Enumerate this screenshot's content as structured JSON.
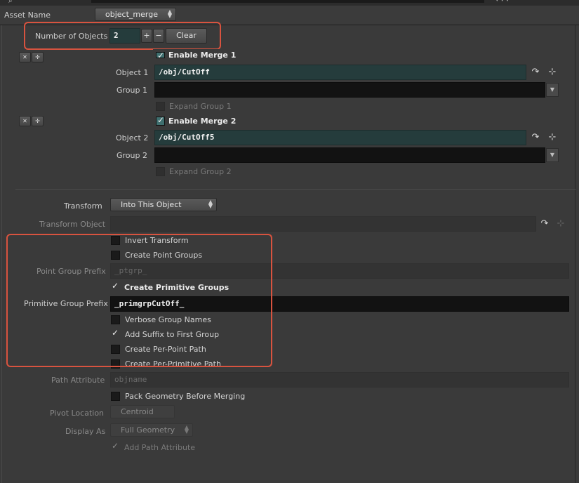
{
  "header": {
    "asset_name_label": "Asset Name",
    "asset_name_value": "object_merge"
  },
  "objects": {
    "label": "Number of Objects",
    "value": "2",
    "plus": "+",
    "minus": "−",
    "clear": "Clear",
    "items": [
      {
        "enable_label": "Enable Merge 1",
        "object_label": "Object 1",
        "object_value": "/obj/CutOff",
        "group_label": "Group 1",
        "group_value": "",
        "expand_label": "Expand Group 1"
      },
      {
        "enable_label": "Enable Merge 2",
        "object_label": "Object 2",
        "object_value": "/obj/CutOff5",
        "group_label": "Group 2",
        "group_value": "",
        "expand_label": "Expand Group 2"
      }
    ]
  },
  "transform": {
    "label": "Transform",
    "value": "Into This Object",
    "object_label": "Transform Object",
    "object_value": ""
  },
  "options": {
    "invert_transform": "Invert Transform",
    "create_point_groups": "Create Point Groups",
    "point_prefix_label": "Point Group Prefix",
    "point_prefix_value": "_ptgrp_",
    "create_primitive_groups": "Create Primitive Groups",
    "prim_prefix_label": "Primitive Group Prefix",
    "prim_prefix_value": "_primgrpCutOff_",
    "verbose_group_names": "Verbose Group Names",
    "add_suffix": "Add Suffix to First Group",
    "per_point_path": "Create Per-Point Path",
    "per_prim_path": "Create Per-Primitive Path"
  },
  "path": {
    "label": "Path Attribute",
    "value": "objname",
    "pack_geometry": "Pack Geometry Before Merging",
    "pivot_label": "Pivot Location",
    "pivot_value": "Centroid",
    "display_label": "Display As",
    "display_value": "Full Geometry",
    "add_path_attr": "Add Path Attribute"
  },
  "icons": [
    "jump-arrow-icon",
    "node-chooser-icon",
    "dropdown-arrow-icon",
    "remove-x-icon",
    "move-icon",
    "checkmark-icon"
  ],
  "colors": {
    "background": "#3a3a3a",
    "highlight": "#d8533f",
    "teal_field": "#253c3c"
  }
}
